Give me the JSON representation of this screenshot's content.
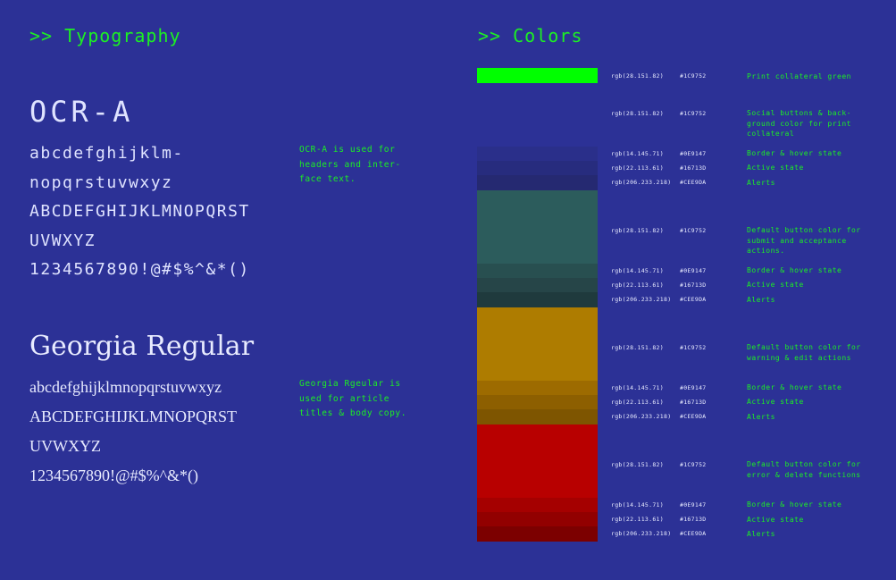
{
  "typography": {
    "title": ">> Typography",
    "ocr": {
      "heading": "OCR-A",
      "lines": [
        "abcdefghijklm-",
        "nopqrstuvwxyz",
        "ABCDEFGHIJKLMNOPQRST",
        "UVWXYZ",
        "1234567890!@#$%^&*()"
      ],
      "note": "OCR-A is used for headers and inter-face text."
    },
    "georgia": {
      "heading": "Georgia Regular",
      "lines": [
        "abcdefghijklmnopqrstuvwxyz",
        "ABCDEFGHIJKLMNOPQRST",
        "UVWXYZ",
        "1234567890!@#$%^&*()"
      ],
      "note": "Georgia Rgeular is used for article titles & body copy."
    }
  },
  "colors": {
    "title": ">> Colors",
    "swatches": [
      {
        "hex": "#00ff00"
      },
      {
        "hex": "#2c3196"
      },
      {
        "hex": "#2a2f8a"
      },
      {
        "hex": "#272c7e"
      },
      {
        "hex": "#252971"
      },
      {
        "hex": "#2c5c5c"
      },
      {
        "hex": "#284f50"
      },
      {
        "hex": "#264548"
      },
      {
        "hex": "#1f3a3d"
      },
      {
        "hex": "#ae7c00"
      },
      {
        "hex": "#9d6b00"
      },
      {
        "hex": "#8d5f00"
      },
      {
        "hex": "#7e5500"
      },
      {
        "hex": "#b80000"
      },
      {
        "hex": "#a50000"
      },
      {
        "hex": "#920000"
      },
      {
        "hex": "#7c0000"
      }
    ],
    "rows": [
      {
        "rgb": "rgb(28.151.82)",
        "hex": "#1C9752",
        "desc": "Print collateral green"
      },
      {
        "rgb": "rgb(28.151.82)",
        "hex": "#1C9752",
        "desc": "Social buttons & back-ground color for print collateral"
      },
      {
        "rgb": "rgb(14.145.71)",
        "hex": "#0E9147",
        "desc": "Border & hover state"
      },
      {
        "rgb": "rgb(22.113.61)",
        "hex": "#16713D",
        "desc": "Active state"
      },
      {
        "rgb": "rgb(206.233.218)",
        "hex": "#CEE9DA",
        "desc": "Alerts"
      },
      {
        "rgb": "rgb(28.151.82)",
        "hex": "#1C9752",
        "desc": "Default button color for submit and acceptance actions."
      },
      {
        "rgb": "rgb(14.145.71)",
        "hex": "#0E9147",
        "desc": "Border & hover state"
      },
      {
        "rgb": "rgb(22.113.61)",
        "hex": "#16713D",
        "desc": "Active state"
      },
      {
        "rgb": "rgb(206.233.218)",
        "hex": "#CEE9DA",
        "desc": "Alerts"
      },
      {
        "rgb": "rgb(28.151.82)",
        "hex": "#1C9752",
        "desc": "Default button color for warning & edit actions"
      },
      {
        "rgb": "rgb(14.145.71)",
        "hex": "#0E9147",
        "desc": "Border & hover state"
      },
      {
        "rgb": "rgb(22.113.61)",
        "hex": "#16713D",
        "desc": "Active state"
      },
      {
        "rgb": "rgb(206.233.218)",
        "hex": "#CEE9DA",
        "desc": "Alerts"
      },
      {
        "rgb": "rgb(28.151.82)",
        "hex": "#1C9752",
        "desc": "Default button color for error & delete functions"
      },
      {
        "rgb": "rgb(14.145.71)",
        "hex": "#0E9147",
        "desc": "Border & hover state"
      },
      {
        "rgb": "rgb(22.113.61)",
        "hex": "#16713D",
        "desc": "Active state"
      },
      {
        "rgb": "rgb(206.233.218)",
        "hex": "#CEE9DA",
        "desc": "Alerts"
      }
    ]
  }
}
